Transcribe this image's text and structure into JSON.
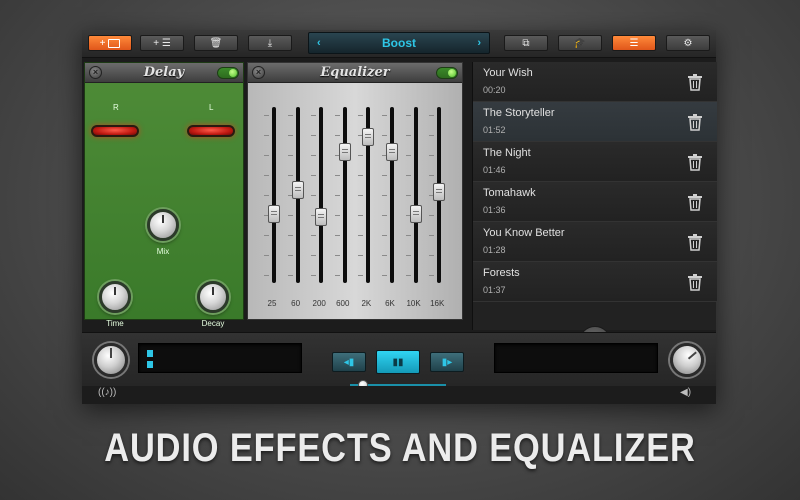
{
  "toolbar": {
    "add_label": "+",
    "eq_add_label": "+ ☰",
    "preset": {
      "prev": "‹",
      "name": "Boost",
      "next": "›"
    }
  },
  "delay": {
    "title": "Delay",
    "close": "×",
    "enabled": true,
    "left_label": "L",
    "right_label": "R",
    "knobs": {
      "mix": "Mix",
      "time": "Time",
      "decay": "Decay"
    }
  },
  "equalizer": {
    "title": "Equalizer",
    "close": "×",
    "enabled": true,
    "bands": [
      {
        "freq": "25",
        "level": 0.38
      },
      {
        "freq": "60",
        "level": 0.53
      },
      {
        "freq": "200",
        "level": 0.36
      },
      {
        "freq": "600",
        "level": 0.77
      },
      {
        "freq": "2K",
        "level": 0.87
      },
      {
        "freq": "6K",
        "level": 0.77
      },
      {
        "freq": "10K",
        "level": 0.38
      },
      {
        "freq": "16K",
        "level": 0.52
      }
    ]
  },
  "playlist": {
    "tracks": [
      {
        "title": "Your Wish",
        "time": "00:20"
      },
      {
        "title": "The Storyteller",
        "time": "01:52",
        "active": true
      },
      {
        "title": "The Night",
        "time": "01:46"
      },
      {
        "title": "Tomahawk",
        "time": "01:36"
      },
      {
        "title": "You Know Better",
        "time": "01:28"
      },
      {
        "title": "Forests",
        "time": "01:37"
      }
    ],
    "add_label": "+"
  },
  "transport": {
    "prev_label": "◂▮",
    "pause_label": "▮▮",
    "next_label": "▮▸",
    "progress": 0.14
  },
  "bottom": {
    "left_icon": "((♪))",
    "right_icon": "◀)"
  },
  "headline": "AUDIO EFFECTS AND EQUALIZER",
  "colors": {
    "accent": "#2ec6e6",
    "orange": "#f06a25",
    "delay_green": "#4a8a35"
  }
}
